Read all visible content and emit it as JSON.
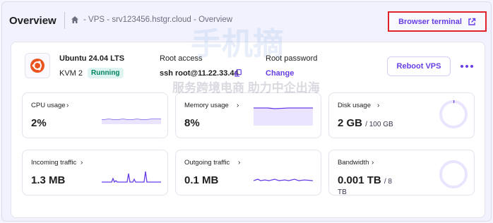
{
  "header": {
    "title": "Overview",
    "breadcrumb": [
      "-",
      "VPS",
      "-",
      "srv123456.hstgr.cloud",
      "-",
      "Overview"
    ],
    "terminal_button": "Browser terminal"
  },
  "server": {
    "os_name": "Ubuntu 24.04 LTS",
    "plan": "KVM 2",
    "status": "Running",
    "root_access_label": "Root access",
    "root_access_value": "ssh root@11.22.33.44",
    "root_password_label": "Root password",
    "root_password_action": "Change",
    "reboot_button": "Reboot VPS"
  },
  "metrics": [
    {
      "label": "CPU usage",
      "value": "2%"
    },
    {
      "label": "Memory usage",
      "value": "8%"
    },
    {
      "label": "Disk usage",
      "value": "2 GB",
      "unit": "/ 100 GB"
    },
    {
      "label": "Incoming traffic",
      "value": "1.3 MB"
    },
    {
      "label": "Outgoing traffic",
      "value": "0.1 MB"
    },
    {
      "label": "Bandwidth",
      "value": "0.001 TB",
      "unit": "/ 8",
      "unit2": "TB"
    }
  ],
  "watermark": {
    "line1": "手机摘",
    "line2": "服务跨境电商 助力中企出海"
  },
  "colors": {
    "accent": "#673de6",
    "running_bg": "#def4f0",
    "running_text": "#008361",
    "highlight_border": "#e0222a",
    "ubuntu": "#e95420"
  }
}
